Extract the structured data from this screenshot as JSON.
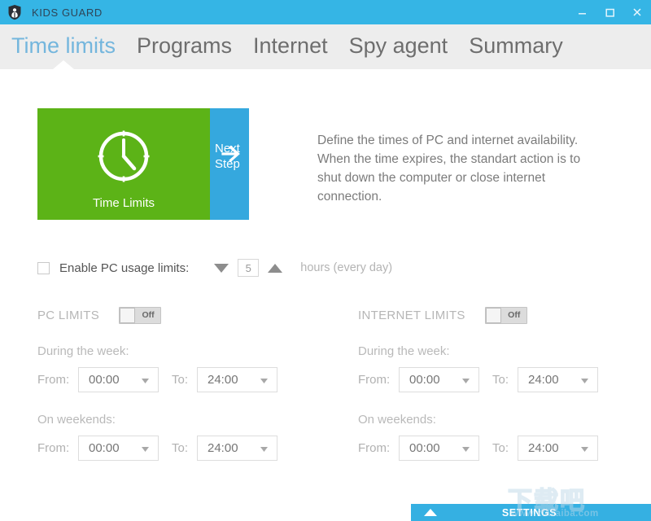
{
  "window": {
    "title": "KIDS GUARD",
    "icon": "shield-person-icon",
    "titlebar_color": "#35b5e5",
    "controls": {
      "minimize": "minimize-icon",
      "maximize": "maximize-icon",
      "close": "close-icon"
    }
  },
  "nav": {
    "active_index": 0,
    "active_color": "#74b6dd",
    "inactive_color": "#6e6e6e",
    "tabs": [
      {
        "label": "Time limits"
      },
      {
        "label": "Programs"
      },
      {
        "label": "Internet"
      },
      {
        "label": "Spy agent"
      },
      {
        "label": "Summary"
      }
    ]
  },
  "hero": {
    "tile": {
      "label": "Time Limits",
      "icon": "clock-icon",
      "color": "#5cb317"
    },
    "next_step": {
      "label": "Next Step",
      "icon": "arrow-right-icon",
      "color": "#35a8de"
    },
    "description": "Define the times of PC and internet availability. When the time expires, the standart action is to shut down the computer or close internet connection."
  },
  "enable_row": {
    "checkbox_checked": false,
    "label": "Enable PC usage limits:",
    "decrement_icon": "triangle-down-icon",
    "increment_icon": "triangle-up-icon",
    "value": "5",
    "units": "hours (every day)"
  },
  "panels": [
    {
      "id": "pc-limits",
      "title": "PC LIMITS",
      "toggle": {
        "state": "Off",
        "enabled": false
      },
      "groups": [
        {
          "title": "During the week:",
          "from_label": "From:",
          "from_value": "00:00",
          "to_label": "To:",
          "to_value": "24:00"
        },
        {
          "title": "On weekends:",
          "from_label": "From:",
          "from_value": "00:00",
          "to_label": "To:",
          "to_value": "24:00"
        }
      ]
    },
    {
      "id": "internet-limits",
      "title": "INTERNET LIMITS",
      "toggle": {
        "state": "Off",
        "enabled": false
      },
      "groups": [
        {
          "title": "During the week:",
          "from_label": "From:",
          "from_value": "00:00",
          "to_label": "To:",
          "to_value": "24:00"
        },
        {
          "title": "On weekends:",
          "from_label": "From:",
          "from_value": "00:00",
          "to_label": "To:",
          "to_value": "24:00"
        }
      ]
    }
  ],
  "settings_bar": {
    "label": "SETTINGS",
    "caret_icon": "chevron-up-icon",
    "color": "#35b0e2"
  },
  "watermark": {
    "text_cn": "下载吧",
    "text_url": "www.xiazaiba.com"
  }
}
